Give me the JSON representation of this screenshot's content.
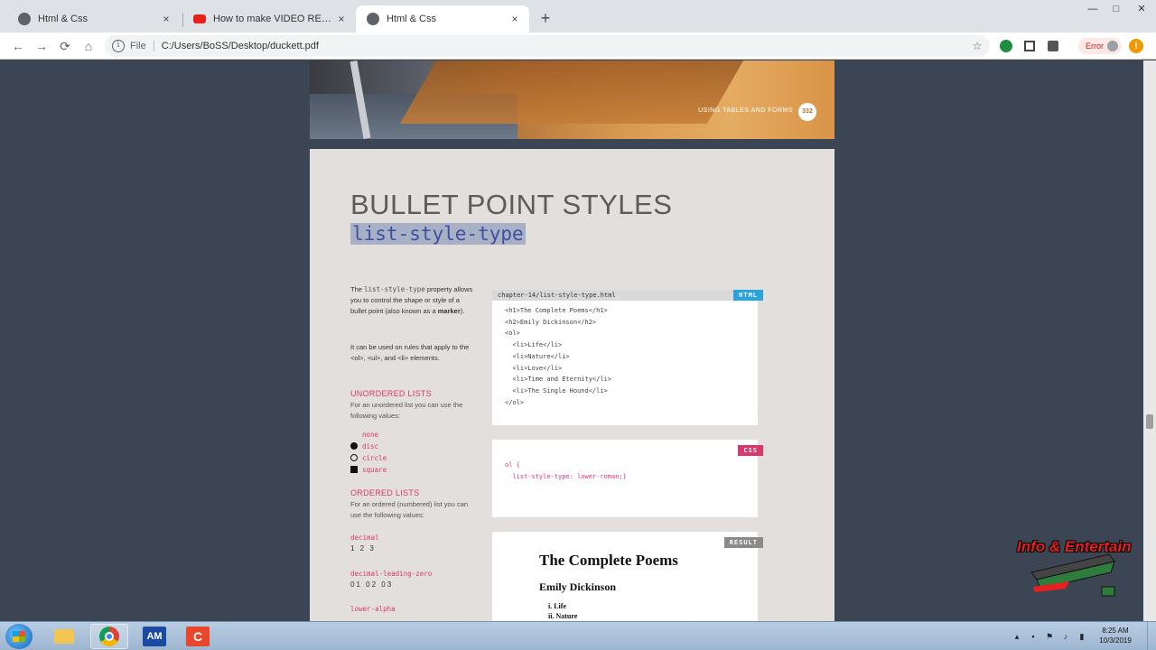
{
  "browser": {
    "tabs": [
      {
        "title": "Html & Css",
        "icon": "globe-icon",
        "active": false
      },
      {
        "title": "How to make VIDEO RESPOND -",
        "icon": "youtube-icon",
        "active": false
      },
      {
        "title": "Html & Css",
        "icon": "globe-icon",
        "active": true
      }
    ],
    "close_glyph": "×",
    "new_tab_glyph": "+",
    "window_controls": {
      "minimize": "—",
      "maximize": "□",
      "close": "✕"
    },
    "nav": {
      "back": "←",
      "forward": "→",
      "reload": "⟳",
      "home": "⌂"
    },
    "address": {
      "scheme": "File",
      "url": "C:/Users/BoSS/Desktop/duckett.pdf",
      "info_glyph": "i"
    },
    "error_label": "Error",
    "menu_glyph": "!",
    "bookmark_glyph": "☆"
  },
  "pdf": {
    "prev_page": {
      "caption": "USING TABLES AND FORMS",
      "page_number": "332"
    },
    "title": "BULLET POINT STYLES",
    "subtitle": "list-style-type",
    "intro": {
      "p1_a": "The ",
      "p1_code": "list-style-type",
      "p1_b": " property allows you to control the shape or style of a bullet point (also known as a ",
      "p1_bold": "marker",
      "p1_c": ").",
      "p2": "It can be used on rules that apply to the <ol>, <ul>, and <li> elements."
    },
    "unordered": {
      "heading": "UNORDERED LISTS",
      "note": "For an unordered list you can use the following values:",
      "values": [
        {
          "label": "none",
          "marker": "none"
        },
        {
          "label": "disc",
          "marker": "disc"
        },
        {
          "label": "circle",
          "marker": "circle"
        },
        {
          "label": "square",
          "marker": "square"
        }
      ]
    },
    "ordered": {
      "heading": "ORDERED LISTS",
      "note": "For an ordered (numbered) list you can use the following values:",
      "values": [
        {
          "label": "decimal",
          "example": "1 2 3"
        },
        {
          "label": "decimal-leading-zero",
          "example": "01 02 03"
        },
        {
          "label": "lower-alpha",
          "example": ""
        }
      ]
    },
    "html_card": {
      "file": "chapter-14/list-style-type.html",
      "badge": "HTML",
      "lines": [
        "<h1>The Complete Poems</h1>",
        "<h2>Emily Dickinson</h2>",
        "<ol>",
        "  <li>Life</li>",
        "  <li>Nature</li>",
        "  <li>Love</li>",
        "  <li>Time and Eternity</li>",
        "  <li>The Single Hound</li>",
        "</ol>"
      ]
    },
    "css_card": {
      "badge": "CSS",
      "lines": [
        "ol {",
        "  list-style-type: lower-roman;}"
      ]
    },
    "result_card": {
      "badge": "RESULT",
      "title": "The Complete Poems",
      "subtitle": "Emily Dickinson",
      "items": [
        "i. Life",
        "ii. Nature"
      ]
    }
  },
  "watermark": {
    "text": "Info & Entertain"
  },
  "taskbar": {
    "apps": [
      "windows-explorer",
      "chrome",
      "am",
      "c-app"
    ],
    "am_label": "AM",
    "c_label": "C",
    "clock_time": "8:25 AM",
    "clock_date": "10/3/2019"
  }
}
